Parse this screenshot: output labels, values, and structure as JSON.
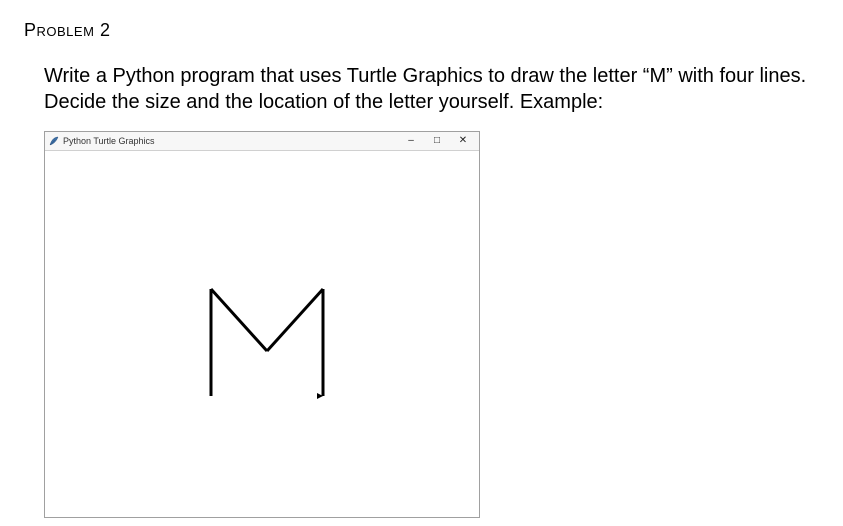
{
  "problem": {
    "label": "Problem",
    "number": "2",
    "instruction": "Write a Python program that uses Turtle Graphics to draw the letter “M” with four lines. Decide the size and the location of the letter yourself.  Example:"
  },
  "window": {
    "title": "Python Turtle Graphics",
    "controls": {
      "minimize": "–",
      "maximize": "□",
      "close": "✕"
    },
    "drawing": {
      "letter": "M"
    }
  }
}
